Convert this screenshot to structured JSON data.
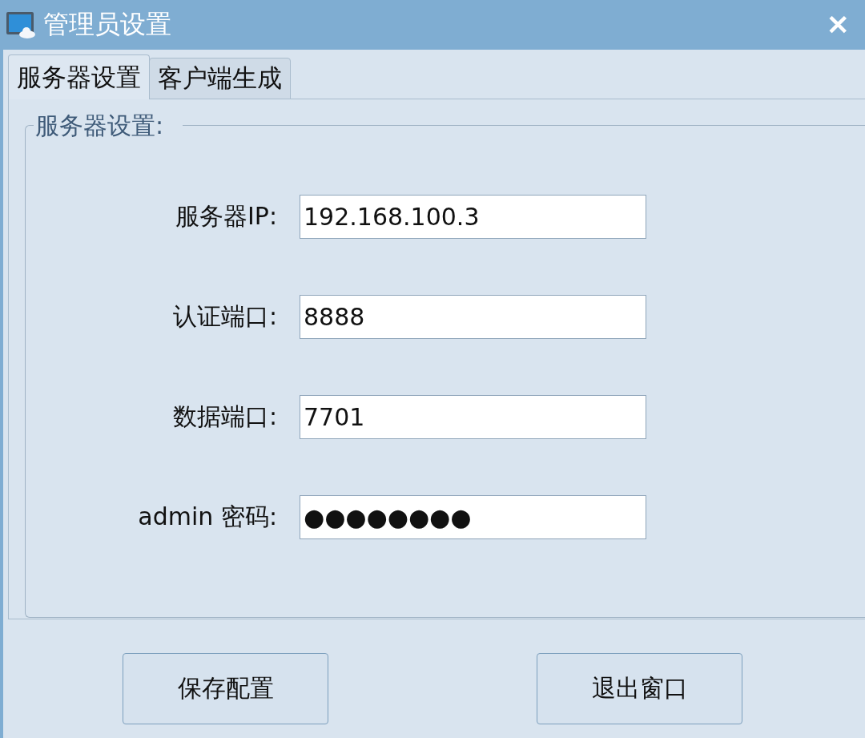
{
  "window": {
    "title": "管理员设置",
    "close": "✕"
  },
  "tabs": [
    {
      "label": "服务器设置",
      "selected": true
    },
    {
      "label": "客户端生成",
      "selected": false
    }
  ],
  "group": {
    "title": "服务器设置:"
  },
  "fields": [
    {
      "label": "服务器IP:",
      "value": "192.168.100.3"
    },
    {
      "label": "认证端口:",
      "value": "8888"
    },
    {
      "label": "数据端口:",
      "value": "7701"
    },
    {
      "label": "admin 密码:",
      "value": "●●●●●●●●"
    }
  ],
  "buttons": [
    "保存配置",
    "退出窗口"
  ]
}
